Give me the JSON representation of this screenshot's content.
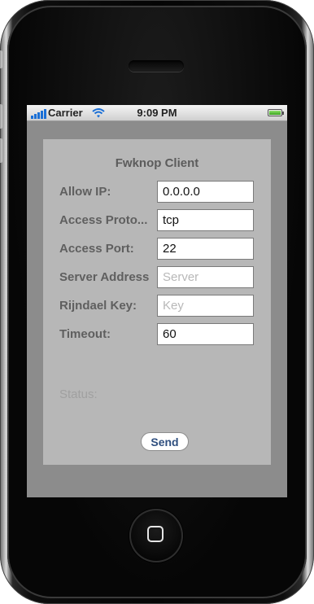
{
  "status_bar": {
    "carrier": "Carrier",
    "time": "9:09 PM"
  },
  "form": {
    "title": "Fwknop Client",
    "fields": [
      {
        "label": "Allow IP:",
        "value": "0.0.0.0",
        "placeholder": ""
      },
      {
        "label": "Access Proto...",
        "value": "tcp",
        "placeholder": ""
      },
      {
        "label": "Access Port:",
        "value": "22",
        "placeholder": ""
      },
      {
        "label": "Server Address",
        "value": "",
        "placeholder": "Server"
      },
      {
        "label": "Rijndael Key:",
        "value": "",
        "placeholder": "Key"
      },
      {
        "label": "Timeout:",
        "value": "60",
        "placeholder": ""
      }
    ],
    "status_label": "Status:",
    "send_label": "Send"
  },
  "colors": {
    "screen_background": "#8c8c8c",
    "panel_background": "#b7b7b7",
    "send_text": "#2f4f7f",
    "signal_bars": "#1a6fd6",
    "battery": "#3aa21d"
  },
  "icons": [
    "signal-bars-icon",
    "wifi-icon",
    "battery-icon",
    "home-square-icon"
  ]
}
